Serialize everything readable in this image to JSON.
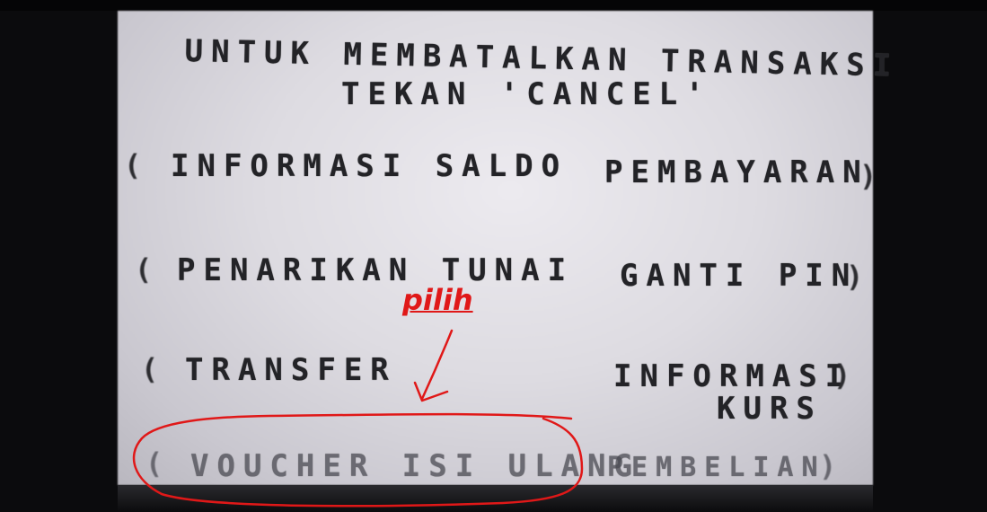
{
  "screen": {
    "header_line1": "UNTUK MEMBATALKAN TRANSAKSI",
    "header_line2": "TEKAN 'CANCEL'",
    "left_options": [
      {
        "label": "INFORMASI SALDO"
      },
      {
        "label": "PENARIKAN TUNAI"
      },
      {
        "label": "TRANSFER"
      },
      {
        "label": "VOUCHER ISI ULANG"
      }
    ],
    "right_options": [
      {
        "label": "PEMBAYARAN"
      },
      {
        "label": "GANTI PIN"
      },
      {
        "label_line1": "INFORMASI",
        "label_line2": "KURS"
      },
      {
        "label": "PEMBELIAN"
      }
    ],
    "bracket_left": "(",
    "bracket_right": ")"
  },
  "annotation": {
    "label": "pilih",
    "color": "#e01818"
  }
}
